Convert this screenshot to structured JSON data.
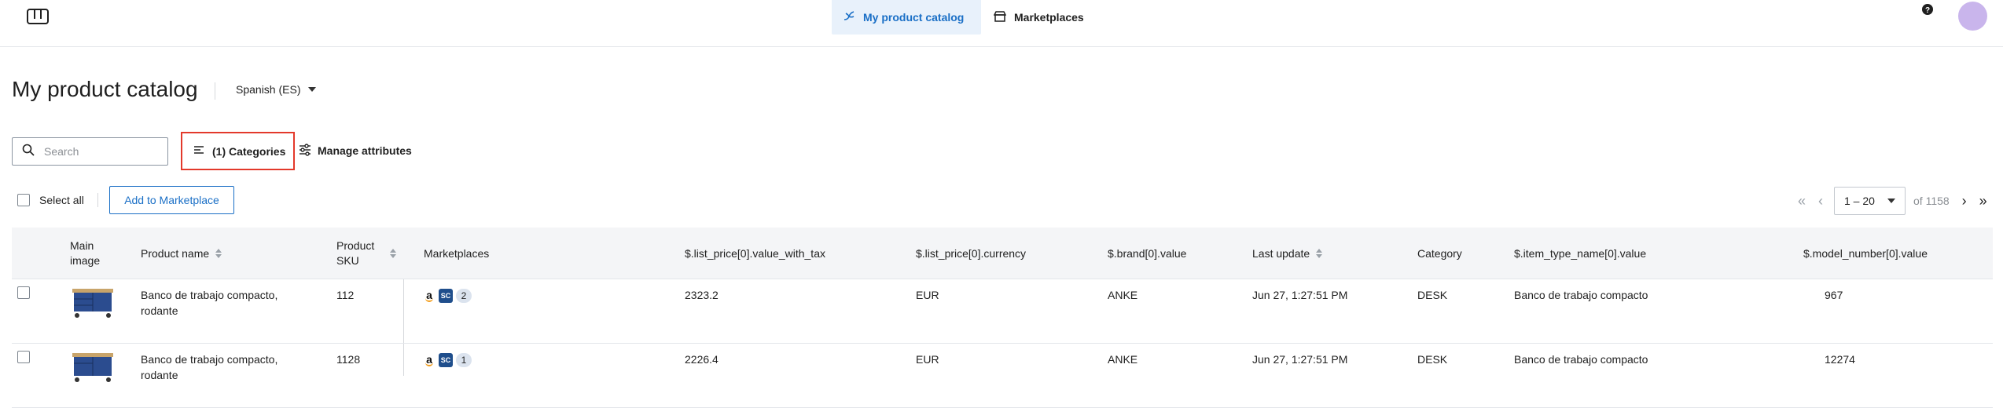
{
  "nav": {
    "tabs": [
      {
        "label": "My product catalog",
        "icon": "hand-leaf-icon",
        "active": true
      },
      {
        "label": "Marketplaces",
        "icon": "store-icon",
        "active": false
      }
    ]
  },
  "page": {
    "title": "My product catalog",
    "language": "Spanish (ES)"
  },
  "toolbar": {
    "search_placeholder": "Search",
    "categories_label": "(1) Categories",
    "manage_attributes_label": "Manage attributes",
    "select_all_label": "Select all",
    "add_to_marketplace_label": "Add to Marketplace"
  },
  "pagination": {
    "range": "1 – 20",
    "of_total": "of 1158"
  },
  "table": {
    "columns": {
      "main_image": "Main image",
      "product_name": "Product name",
      "product_sku": "Product SKU",
      "marketplaces": "Marketplaces",
      "list_price": "$.list_price[0].value_with_tax",
      "currency": "$.list_price[0].currency",
      "brand": "$.brand[0].value",
      "last_update": "Last update",
      "category": "Category",
      "item_type": "$.item_type_name[0].value",
      "model_number": "$.model_number[0].value"
    },
    "rows": [
      {
        "product_name": "Banco de trabajo compacto, rodante",
        "sku": "112",
        "marketplace_count": "2",
        "price": "2323.2",
        "currency": "EUR",
        "brand": "ANKE",
        "last_update": "Jun 27, 1:27:51 PM",
        "category": "DESK",
        "item_type": "Banco de trabajo compacto",
        "model_number": "967"
      },
      {
        "product_name": "Banco de trabajo compacto, rodante",
        "sku": "1128",
        "marketplace_count": "1",
        "price": "2226.4",
        "currency": "EUR",
        "brand": "ANKE",
        "last_update": "Jun 27, 1:27:51 PM",
        "category": "DESK",
        "item_type": "Banco de trabajo compacto",
        "model_number": "12274"
      }
    ]
  },
  "marketplace_badges": {
    "amazon": "a",
    "sc": "SC"
  },
  "colors": {
    "accent": "#1a6fc6",
    "highlight_border": "#e3392b",
    "avatar": "#c9b5ec"
  }
}
